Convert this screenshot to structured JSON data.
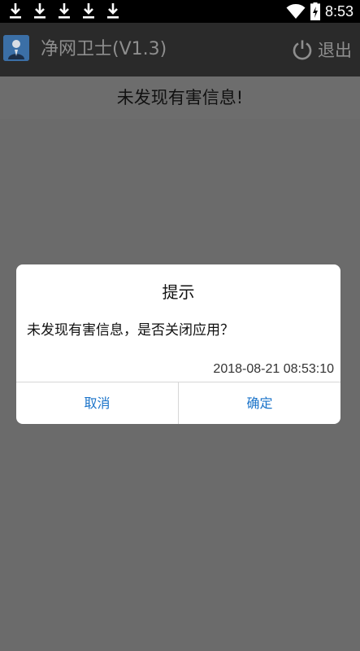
{
  "status_bar": {
    "time": "8:53",
    "download_icon_count": 5,
    "icons": [
      "download-icon",
      "wifi-icon",
      "battery-charging-icon"
    ]
  },
  "app_bar": {
    "title": "净网卫士(V1.3)",
    "exit_label": "退出",
    "logo_icon": "app-logo-icon",
    "exit_icon": "power-icon"
  },
  "main": {
    "result_text": "未发现有害信息!"
  },
  "dialog": {
    "title": "提示",
    "message": "未发现有害信息，是否关闭应用？",
    "timestamp": "2018-08-21 08:53:10",
    "cancel_label": "取消",
    "ok_label": "确定"
  },
  "colors": {
    "status_bar_bg": "#000000",
    "app_bar_bg": "#2a2a2a",
    "overlay_bg": "#6b6b6b",
    "dialog_button_text": "#1a73c9"
  }
}
